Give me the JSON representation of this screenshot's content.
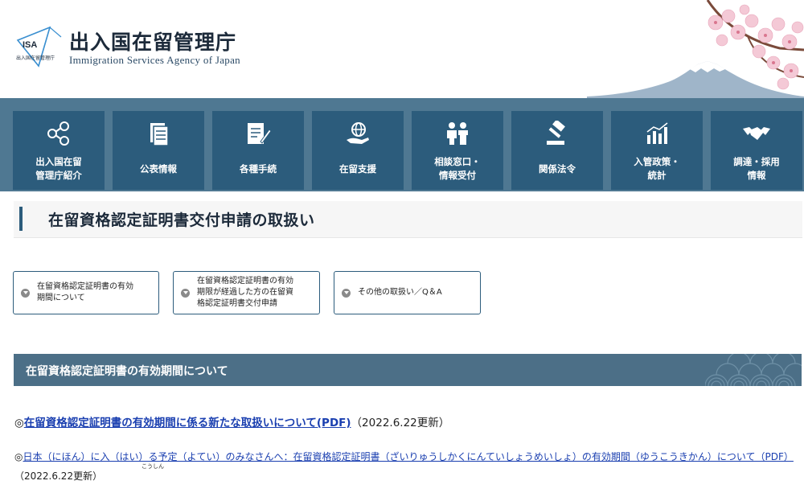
{
  "header": {
    "logo_text": "ISA",
    "logo_subtext": "出入国在留管理庁",
    "agency_name_jp": "出入国在留管理庁",
    "agency_name_en": "Immigration Services Agency of Japan"
  },
  "nav": {
    "items": [
      {
        "icon": "org-chart-icon",
        "label": "出入国在留\n管理庁紹介"
      },
      {
        "icon": "documents-icon",
        "label": "公表情報"
      },
      {
        "icon": "form-pen-icon",
        "label": "各種手続"
      },
      {
        "icon": "globe-hand-icon",
        "label": "在留支援"
      },
      {
        "icon": "consultation-icon",
        "label": "相談窓口・\n情報受付"
      },
      {
        "icon": "gavel-icon",
        "label": "関係法令"
      },
      {
        "icon": "statistics-icon",
        "label": "入管政策・\n統計"
      },
      {
        "icon": "handshake-icon",
        "label": "調達・採用\n情報"
      }
    ]
  },
  "page": {
    "title": "在留資格認定証明書交付申請の取扱い"
  },
  "anchors": [
    {
      "label": "在留資格認定証明書の有効\n期間について"
    },
    {
      "label": "在留資格認定証明書の有効\n期限が経過した方の在留資\n格認定証明書交付申請"
    },
    {
      "label": "その他の取扱い／Q＆A"
    }
  ],
  "section": {
    "title": "在留資格認定証明書の有効期間について"
  },
  "links": {
    "item1": {
      "prefix": "◎",
      "link_text": "在留資格認定証明書の有効期間に係る新たな取扱いについて(PDF)",
      "suffix": "（2022.6.22更新）"
    },
    "item2": {
      "prefix": "◎",
      "link_text": "日本（にほん）に入（はい）る予定（よてい）のみなさんへ：在留資格認定証明書（ざいりゅうしかくにんていしょうめいしょ）の有効期間（ゆうこうきかん）について（PDF）",
      "suffix": "（2022.6.22更新）",
      "ruby": "こうしん"
    }
  },
  "colors": {
    "nav_background": "#4f7892",
    "nav_tile": "#2c5c7c",
    "section_heading": "#4c6f87",
    "link": "#1a3fb0"
  }
}
